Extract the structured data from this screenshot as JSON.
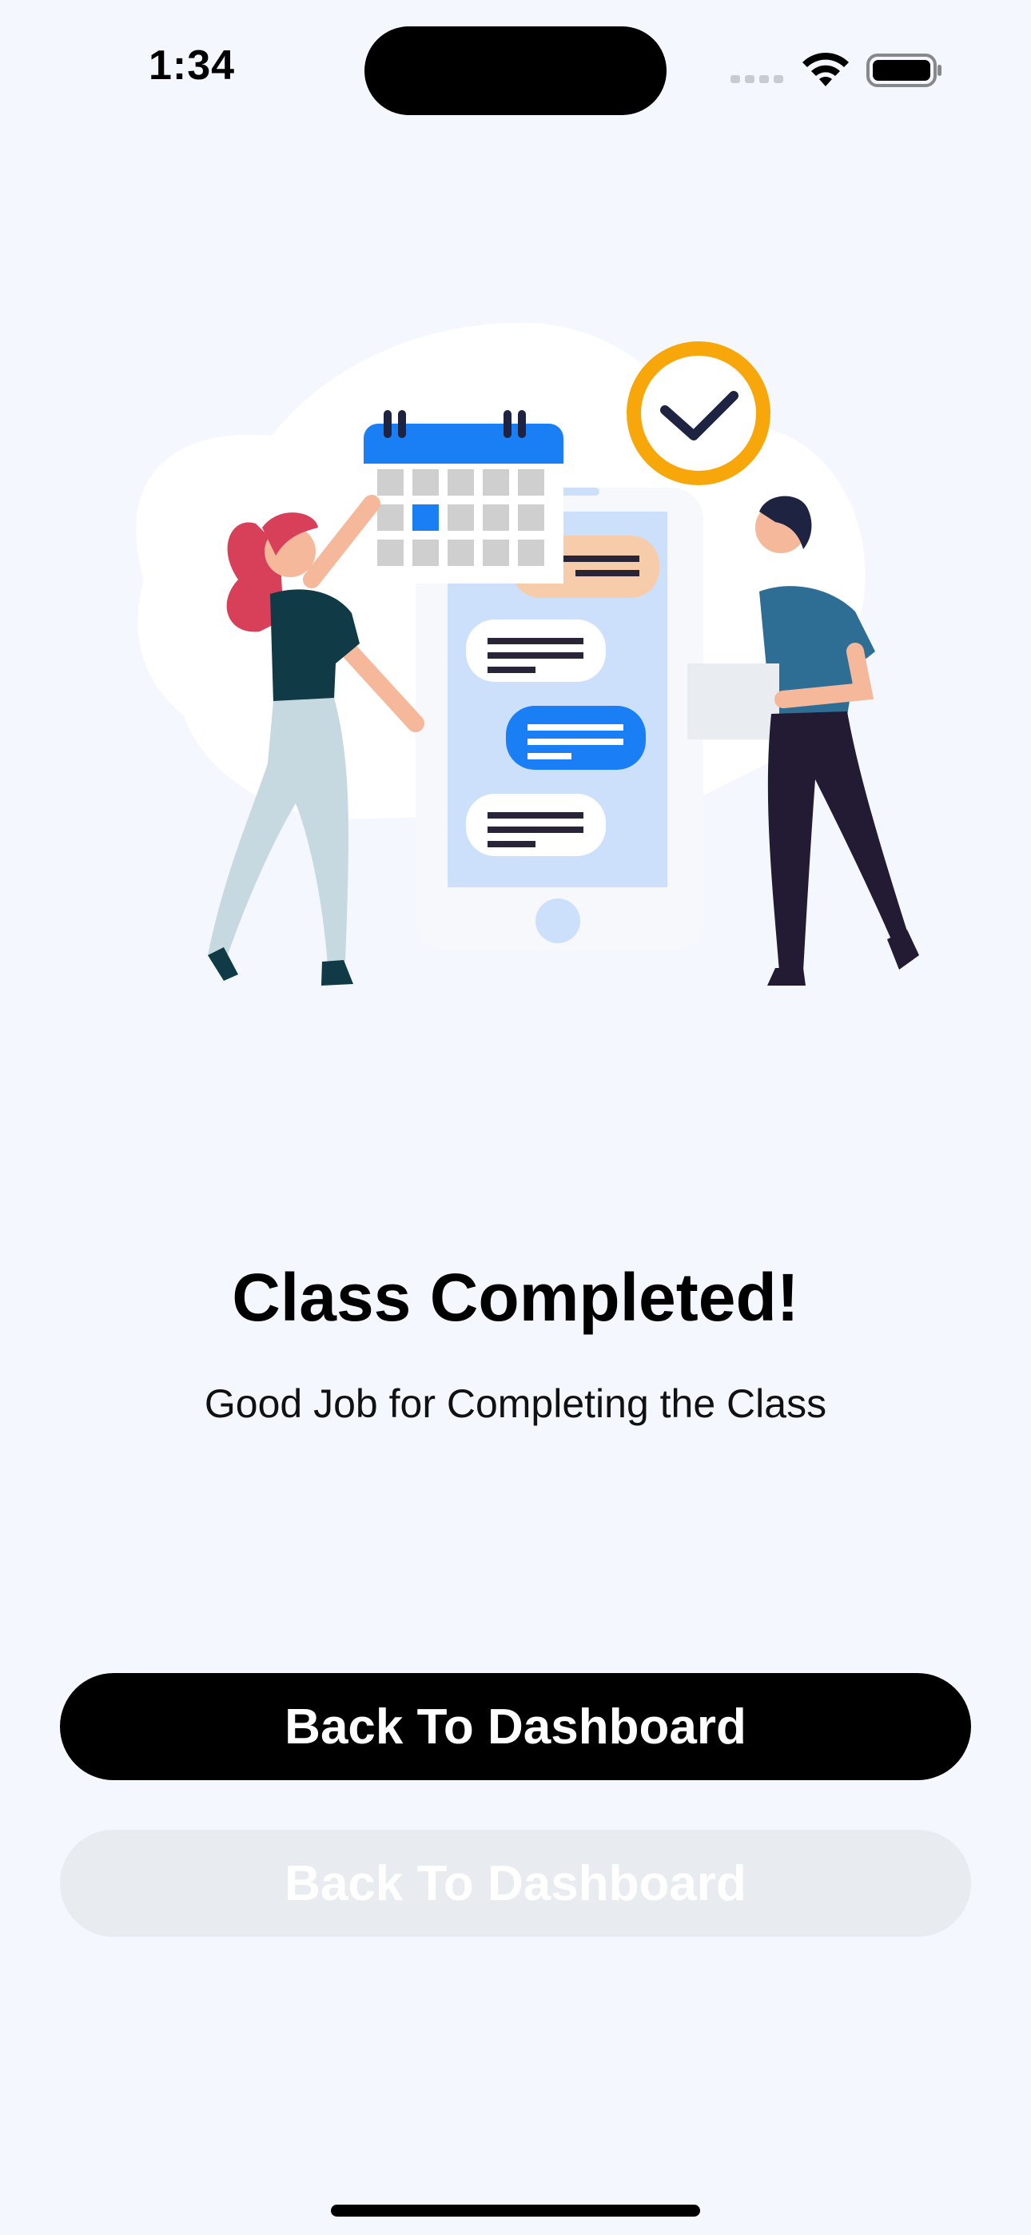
{
  "status_bar": {
    "time": "1:34"
  },
  "main": {
    "title": "Class Completed!",
    "subtitle": "Good Job for Completing the Class"
  },
  "buttons": {
    "primary_label": "Back To Dashboard",
    "secondary_label": "Back To Dashboard"
  },
  "colors": {
    "background": "#f4f7fe",
    "primary_button": "#000000",
    "secondary_button": "#e8ebf0",
    "accent_blue": "#1a7ff5",
    "accent_orange": "#f7a70a"
  },
  "icons": {
    "signal": "cellular-signal-icon",
    "wifi": "wifi-icon",
    "battery": "battery-icon"
  }
}
